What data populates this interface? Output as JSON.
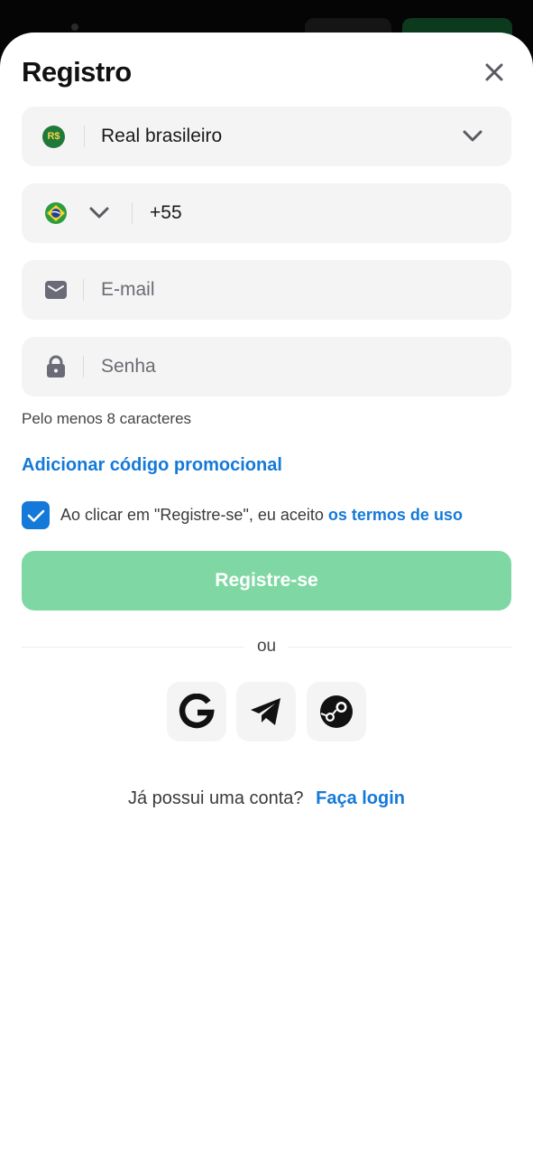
{
  "modal": {
    "title": "Registro"
  },
  "currency": {
    "badge": "R$",
    "label": "Real brasileiro"
  },
  "phone": {
    "country": "Brazil",
    "code": "+55"
  },
  "email": {
    "placeholder": "E-mail"
  },
  "password": {
    "placeholder": "Senha",
    "hint": "Pelo menos 8 caracteres"
  },
  "promo": {
    "label": "Adicionar código promocional"
  },
  "terms": {
    "checked": true,
    "text": "Ao clicar em \"Registre-se\", eu aceito",
    "link": "os termos de uso"
  },
  "submit": {
    "label": "Registre-se"
  },
  "divider": {
    "label": "ou"
  },
  "social": {
    "icons": [
      "google-icon",
      "telegram-icon",
      "steam-icon"
    ]
  },
  "login": {
    "question": "Já possui uma conta?",
    "link": "Faça login"
  },
  "colors": {
    "accent": "#1479d9",
    "submit_disabled": "#7fd8a3",
    "field_bg": "#f4f4f5"
  }
}
